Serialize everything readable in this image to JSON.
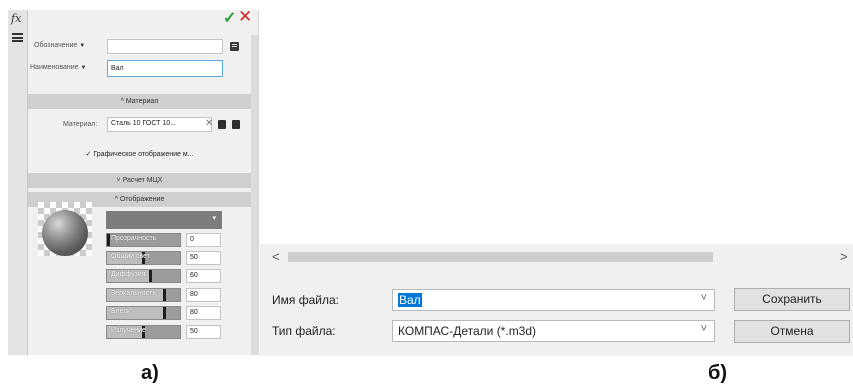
{
  "panel": {
    "fx_label": "fx",
    "fields": {
      "designation_label": "Обозначение",
      "designation_value": "",
      "name_label": "Наименование",
      "name_value": "Вал",
      "dropdown_caret": "▼"
    },
    "material_section": "^ Материал",
    "material_label": "Материал:",
    "material_value": "Сталь 10 ГОСТ 10...",
    "material_clear": "✕",
    "graphic_display": "✓ Графическое отображение м...",
    "mass_section": "˅ Расчет МЦХ",
    "display_section": "^ Отображение",
    "dropdown_chevron": "▾",
    "properties": [
      {
        "name": "Прозрачность",
        "value": "0",
        "level": 0
      },
      {
        "name": "Общий свет",
        "value": "50",
        "level": 0.5
      },
      {
        "name": "Диффузия",
        "value": "60",
        "level": 0.6
      },
      {
        "name": "Зеркальность",
        "value": "80",
        "level": 0.8
      },
      {
        "name": "Блеск",
        "value": "80",
        "level": 0.8
      },
      {
        "name": "Излучение",
        "value": "50",
        "level": 0.5
      }
    ],
    "icons": {
      "apply": "checkmark-icon",
      "cancel": "close-icon"
    }
  },
  "caption_a": "а)",
  "dialog": {
    "scroll_left": "<",
    "scroll_right": ">",
    "filename_label": "Имя файла:",
    "filename_value": "Вал",
    "filetype_label": "Тип файла:",
    "filetype_value": "КОМПАС-Детали (*.m3d)",
    "save_button": "Сохранить",
    "cancel_button": "Отмена",
    "chevron": "˅"
  },
  "caption_b": "б)",
  "colors": {
    "accent": "#0078d7",
    "apply": "#2f9e3a",
    "cancel": "#d22828"
  }
}
